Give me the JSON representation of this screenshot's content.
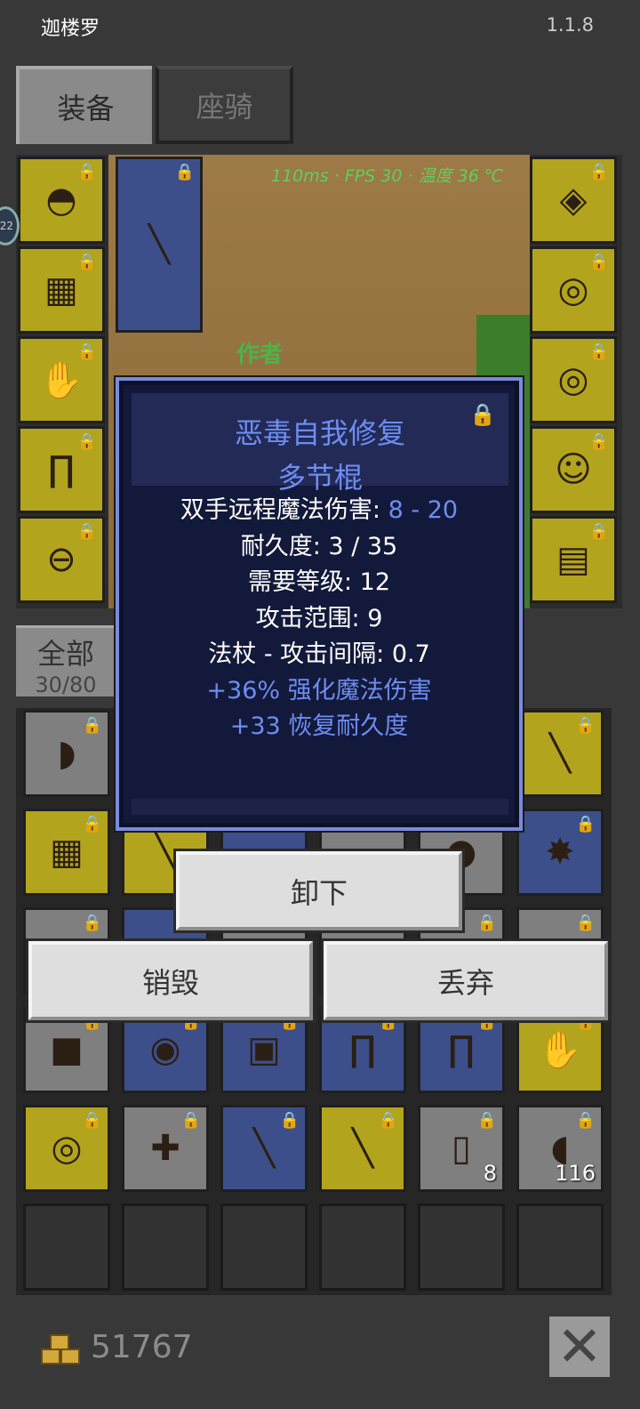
{
  "app": {
    "title": "迦楼罗",
    "version": "1.1.8"
  },
  "tabs": [
    {
      "label": "装备"
    },
    {
      "label": "座骑"
    }
  ],
  "hud": {
    "fps_text": "110ms · FPS 30 · 温度 36 ℃",
    "author_label": "作者",
    "side_badge": "22"
  },
  "equipment": {
    "left": [
      {
        "icon": "helmet-icon"
      },
      {
        "icon": "chest-armor-icon"
      },
      {
        "icon": "gloves-icon"
      },
      {
        "icon": "leg-armor-icon"
      },
      {
        "icon": "belt-icon"
      }
    ],
    "weapon": {
      "icon": "staff-icon"
    },
    "right": [
      {
        "icon": "necklace-icon"
      },
      {
        "icon": "ring-icon"
      },
      {
        "icon": "ring-icon"
      },
      {
        "icon": "pet-icon"
      },
      {
        "icon": "map-icon"
      }
    ]
  },
  "filter": {
    "label": "全部",
    "count": "30/80"
  },
  "inventory": {
    "rows": [
      [
        {
          "icon": "bow-icon",
          "bg": "g"
        },
        {
          "icon": "",
          "bg": "g"
        },
        {
          "icon": "",
          "bg": "g"
        },
        {
          "icon": "",
          "bg": "g"
        },
        {
          "icon": "",
          "bg": "g"
        },
        {
          "icon": "sword-icon",
          "bg": "y"
        }
      ],
      [
        {
          "icon": "chest-armor-icon",
          "bg": "y"
        },
        {
          "icon": "staff-icon",
          "bg": "y"
        },
        {
          "icon": "",
          "bg": "b"
        },
        {
          "icon": "",
          "bg": "g"
        },
        {
          "icon": "orb-icon",
          "bg": "g"
        },
        {
          "icon": "spiked-orb-icon",
          "bg": "b"
        }
      ],
      [
        {
          "icon": "",
          "bg": "g"
        },
        {
          "icon": "",
          "bg": "b"
        },
        {
          "icon": "",
          "bg": "g"
        },
        {
          "icon": "",
          "bg": "g"
        },
        {
          "icon": "",
          "bg": "g"
        },
        {
          "icon": "",
          "bg": "g"
        }
      ],
      [
        {
          "icon": "gem-icon",
          "bg": "g"
        },
        {
          "icon": "amulet-icon",
          "bg": "b"
        },
        {
          "icon": "armor-icon",
          "bg": "b"
        },
        {
          "icon": "boots-icon",
          "bg": "b"
        },
        {
          "icon": "boots-icon",
          "bg": "b"
        },
        {
          "icon": "gloves-icon",
          "bg": "y"
        }
      ],
      [
        {
          "icon": "ring-icon",
          "bg": "y"
        },
        {
          "icon": "crossbow-icon",
          "bg": "g"
        },
        {
          "icon": "staff-icon",
          "bg": "b"
        },
        {
          "icon": "staff-icon",
          "bg": "y"
        },
        {
          "icon": "scroll-icon",
          "bg": "g",
          "count": "8"
        },
        {
          "icon": "meat-icon",
          "bg": "g",
          "count": "116"
        }
      ],
      [
        {
          "icon": "",
          "bg": "e"
        },
        {
          "icon": "",
          "bg": "e"
        },
        {
          "icon": "",
          "bg": "e"
        },
        {
          "icon": "",
          "bg": "e"
        },
        {
          "icon": "",
          "bg": "e"
        },
        {
          "icon": "",
          "bg": "e"
        }
      ]
    ]
  },
  "tooltip": {
    "name_line1": "恶毒自我修复",
    "name_line2": "多节棍",
    "damage_label": "双手远程魔法伤害: ",
    "damage_value": "8 - 20",
    "durability": "耐久度: 3 / 35",
    "level": "需要等级: 12",
    "range": "攻击范围: 9",
    "interval": "法杖 - 攻击间隔: 0.7",
    "bonus1": "+36% 强化魔法伤害",
    "bonus2": "+33 恢复耐久度"
  },
  "buttons": {
    "unequip": "卸下",
    "destroy": "销毁",
    "drop": "丢弃"
  },
  "gold": "51767",
  "colors": {
    "rarity_yellow": "#b3a41d",
    "rarity_blue": "#3d4f8a",
    "magic_text": "#6d8df2"
  }
}
